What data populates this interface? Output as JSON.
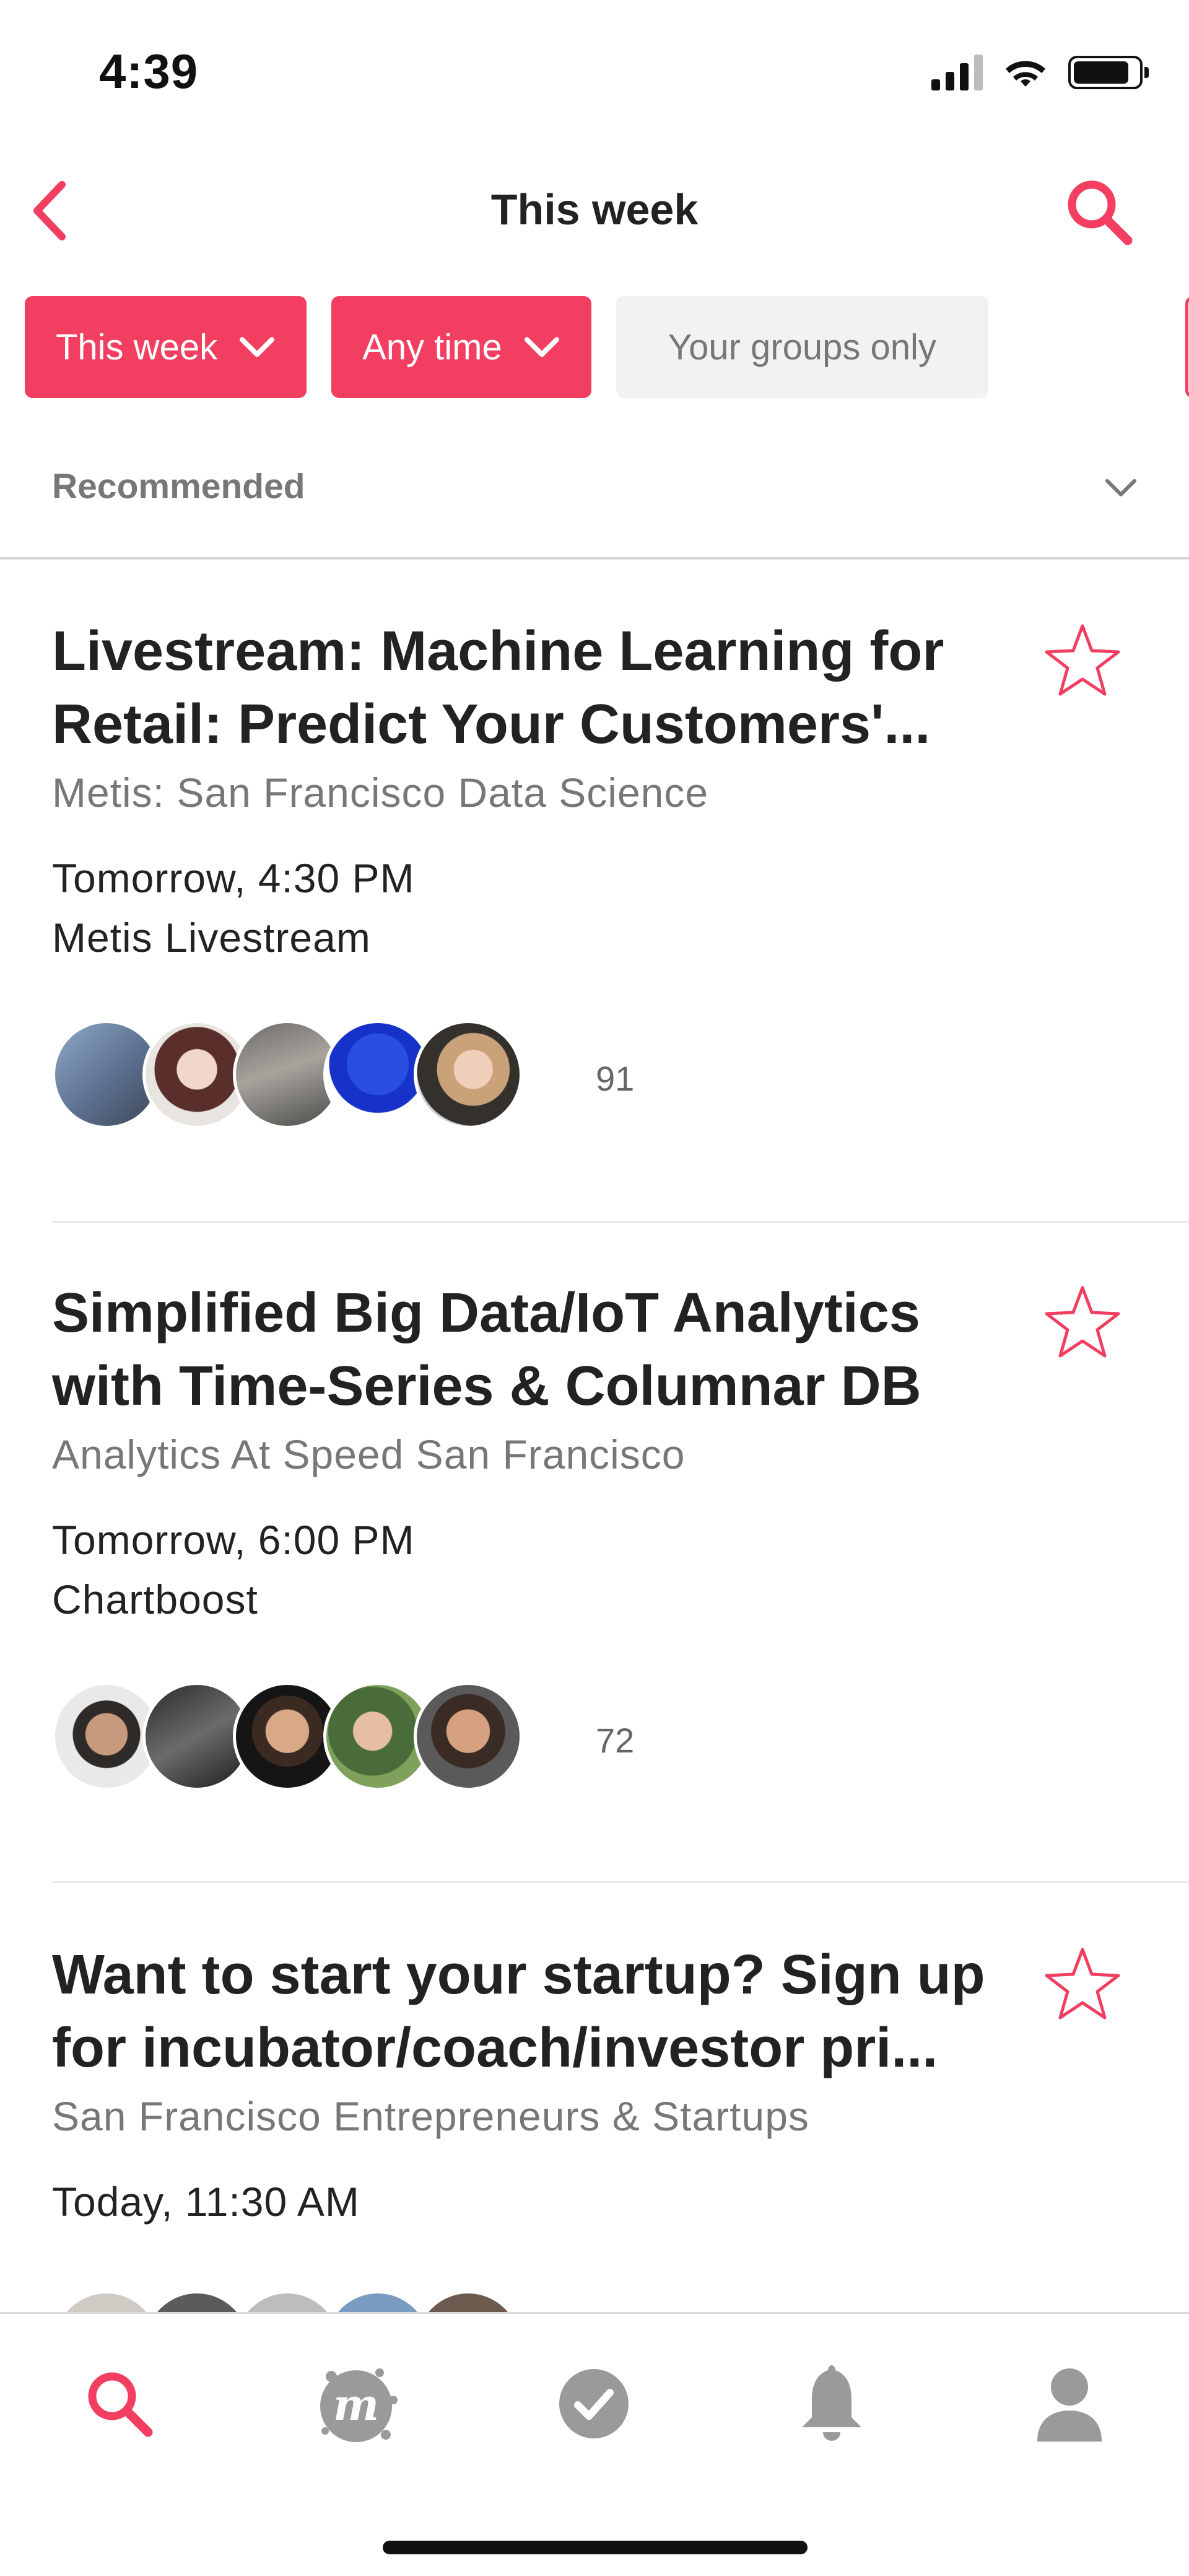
{
  "status_bar": {
    "time": "4:39"
  },
  "nav": {
    "title": "This week"
  },
  "filters": [
    {
      "label": "This week",
      "style": "selected"
    },
    {
      "label": "Any time",
      "style": "selected"
    },
    {
      "label": "Your groups only",
      "style": "unselected"
    }
  ],
  "sort": {
    "label": "Recommended"
  },
  "events": [
    {
      "title": "Livestream: Machine Learning for Retail: Predict Your Customers'...",
      "group": "Metis: San Francisco Data Science",
      "time": "Tomorrow, 4:30 PM",
      "venue": "Metis Livestream",
      "attendee_count": "91"
    },
    {
      "title": "Simplified Big Data/IoT Analytics with Time-Series & Columnar DB",
      "group": "Analytics At Speed San Francisco",
      "time": "Tomorrow, 6:00 PM",
      "venue": "Chartboost",
      "attendee_count": "72"
    },
    {
      "title": "Want to start your startup? Sign up for incubator/coach/investor pri...",
      "group": "San Francisco Entrepreneurs & Startups",
      "time": "Today, 11:30 AM",
      "venue": "",
      "attendee_count": ""
    }
  ],
  "tabs": [
    {
      "icon": "search-icon",
      "active": true
    },
    {
      "icon": "meetup-logo-icon",
      "active": false
    },
    {
      "icon": "checkmark-circle-icon",
      "active": false
    },
    {
      "icon": "bell-icon",
      "active": false
    },
    {
      "icon": "profile-icon",
      "active": false
    }
  ],
  "colors": {
    "accent": "#f13e61",
    "muted": "#777777",
    "icon_grey": "#9a9a9a"
  }
}
